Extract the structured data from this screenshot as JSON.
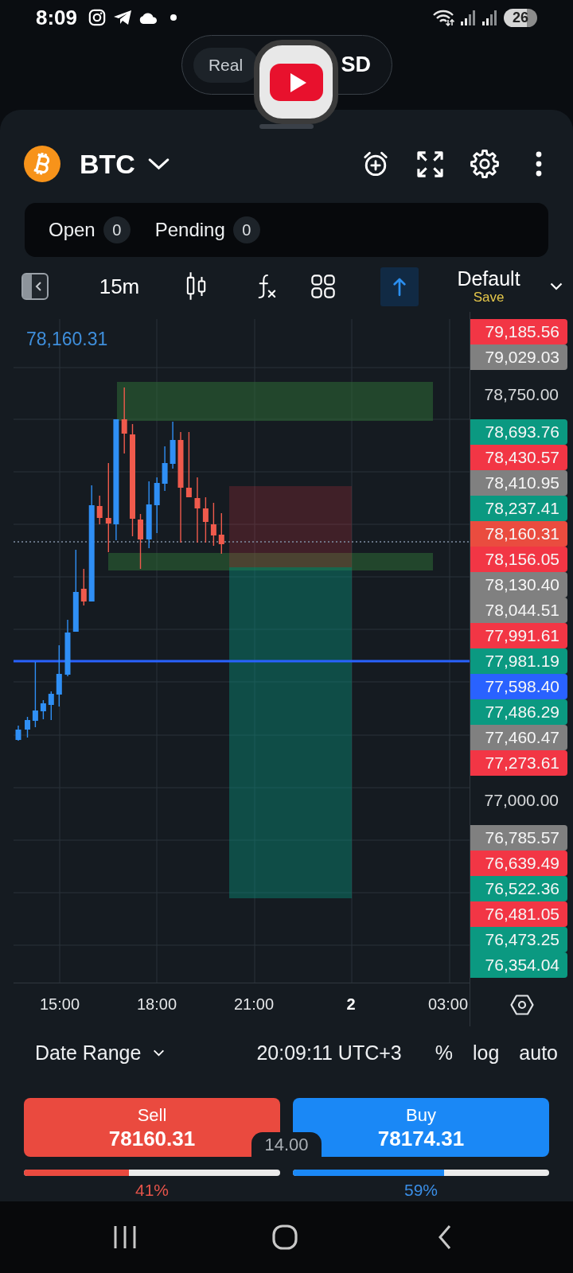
{
  "status_bar": {
    "time": "8:09",
    "battery": "26"
  },
  "account_switch": {
    "mode": {
      "label": "Real",
      "selected": true
    },
    "currency": "SD"
  },
  "header": {
    "symbol": "BTC"
  },
  "positions": [
    {
      "label": "Open",
      "count": "0"
    },
    {
      "label": "Pending",
      "count": "0"
    }
  ],
  "toolbar": {
    "interval": "15m",
    "drawing_tool_selected": true,
    "template": "Default",
    "save": "Save"
  },
  "chart": {
    "legend_price": "78,160.31",
    "price_scale": [
      {
        "kind": "tag",
        "text": "79,185.56",
        "color": "#f23645"
      },
      {
        "kind": "tag",
        "text": "79,029.03",
        "color": "#808080"
      },
      {
        "kind": "tick",
        "text": "78,750.00"
      },
      {
        "kind": "tag",
        "text": "78,693.76",
        "color": "#0b9981"
      },
      {
        "kind": "tag",
        "text": "78,430.57",
        "color": "#f23645"
      },
      {
        "kind": "tag",
        "text": "78,410.95",
        "color": "#808080"
      },
      {
        "kind": "tag",
        "text": "78,237.41",
        "color": "#0b9981"
      },
      {
        "kind": "tag",
        "text": "78,160.31",
        "color": "#ea4c3f"
      },
      {
        "kind": "tag",
        "text": "78,156.05",
        "color": "#f23645"
      },
      {
        "kind": "tag",
        "text": "78,130.40",
        "color": "#808080"
      },
      {
        "kind": "tag",
        "text": "78,044.51",
        "color": "#808080"
      },
      {
        "kind": "tag",
        "text": "77,991.61",
        "color": "#f23645"
      },
      {
        "kind": "tag",
        "text": "77,981.19",
        "color": "#0b9981"
      },
      {
        "kind": "tag",
        "text": "77,598.40",
        "color": "#2962ff"
      },
      {
        "kind": "tag",
        "text": "77,486.29",
        "color": "#0b9981"
      },
      {
        "kind": "tag",
        "text": "77,460.47",
        "color": "#808080"
      },
      {
        "kind": "tag",
        "text": "77,273.61",
        "color": "#f23645"
      },
      {
        "kind": "tick",
        "text": "77,000.00"
      },
      {
        "kind": "tag",
        "text": "76,785.57",
        "color": "#808080"
      },
      {
        "kind": "tag",
        "text": "76,639.49",
        "color": "#f23645"
      },
      {
        "kind": "tag",
        "text": "76,522.36",
        "color": "#0b9981"
      },
      {
        "kind": "tag",
        "text": "76,481.05",
        "color": "#f23645"
      },
      {
        "kind": "tag",
        "text": "76,473.25",
        "color": "#0b9981"
      },
      {
        "kind": "tag",
        "text": "76,354.04",
        "color": "#0b9981"
      }
    ],
    "time_axis": [
      {
        "kind": "time",
        "text": "15:00"
      },
      {
        "kind": "time",
        "text": "18:00"
      },
      {
        "kind": "time",
        "text": "21:00"
      },
      {
        "kind": "day",
        "text": "2"
      },
      {
        "kind": "time",
        "text": "03:00"
      }
    ]
  },
  "bottom_bar": {
    "date_range": "Date Range",
    "clock": "20:09:11 UTC+3",
    "scale_options": [
      "%",
      "log",
      "auto"
    ]
  },
  "trade": {
    "sell": {
      "label": "Sell",
      "price": "78160.31",
      "level": 0.41,
      "share": "41%"
    },
    "spread": "14.00",
    "buy": {
      "label": "Buy",
      "price": "78174.31",
      "level": 0.59,
      "share": "59%"
    }
  }
}
